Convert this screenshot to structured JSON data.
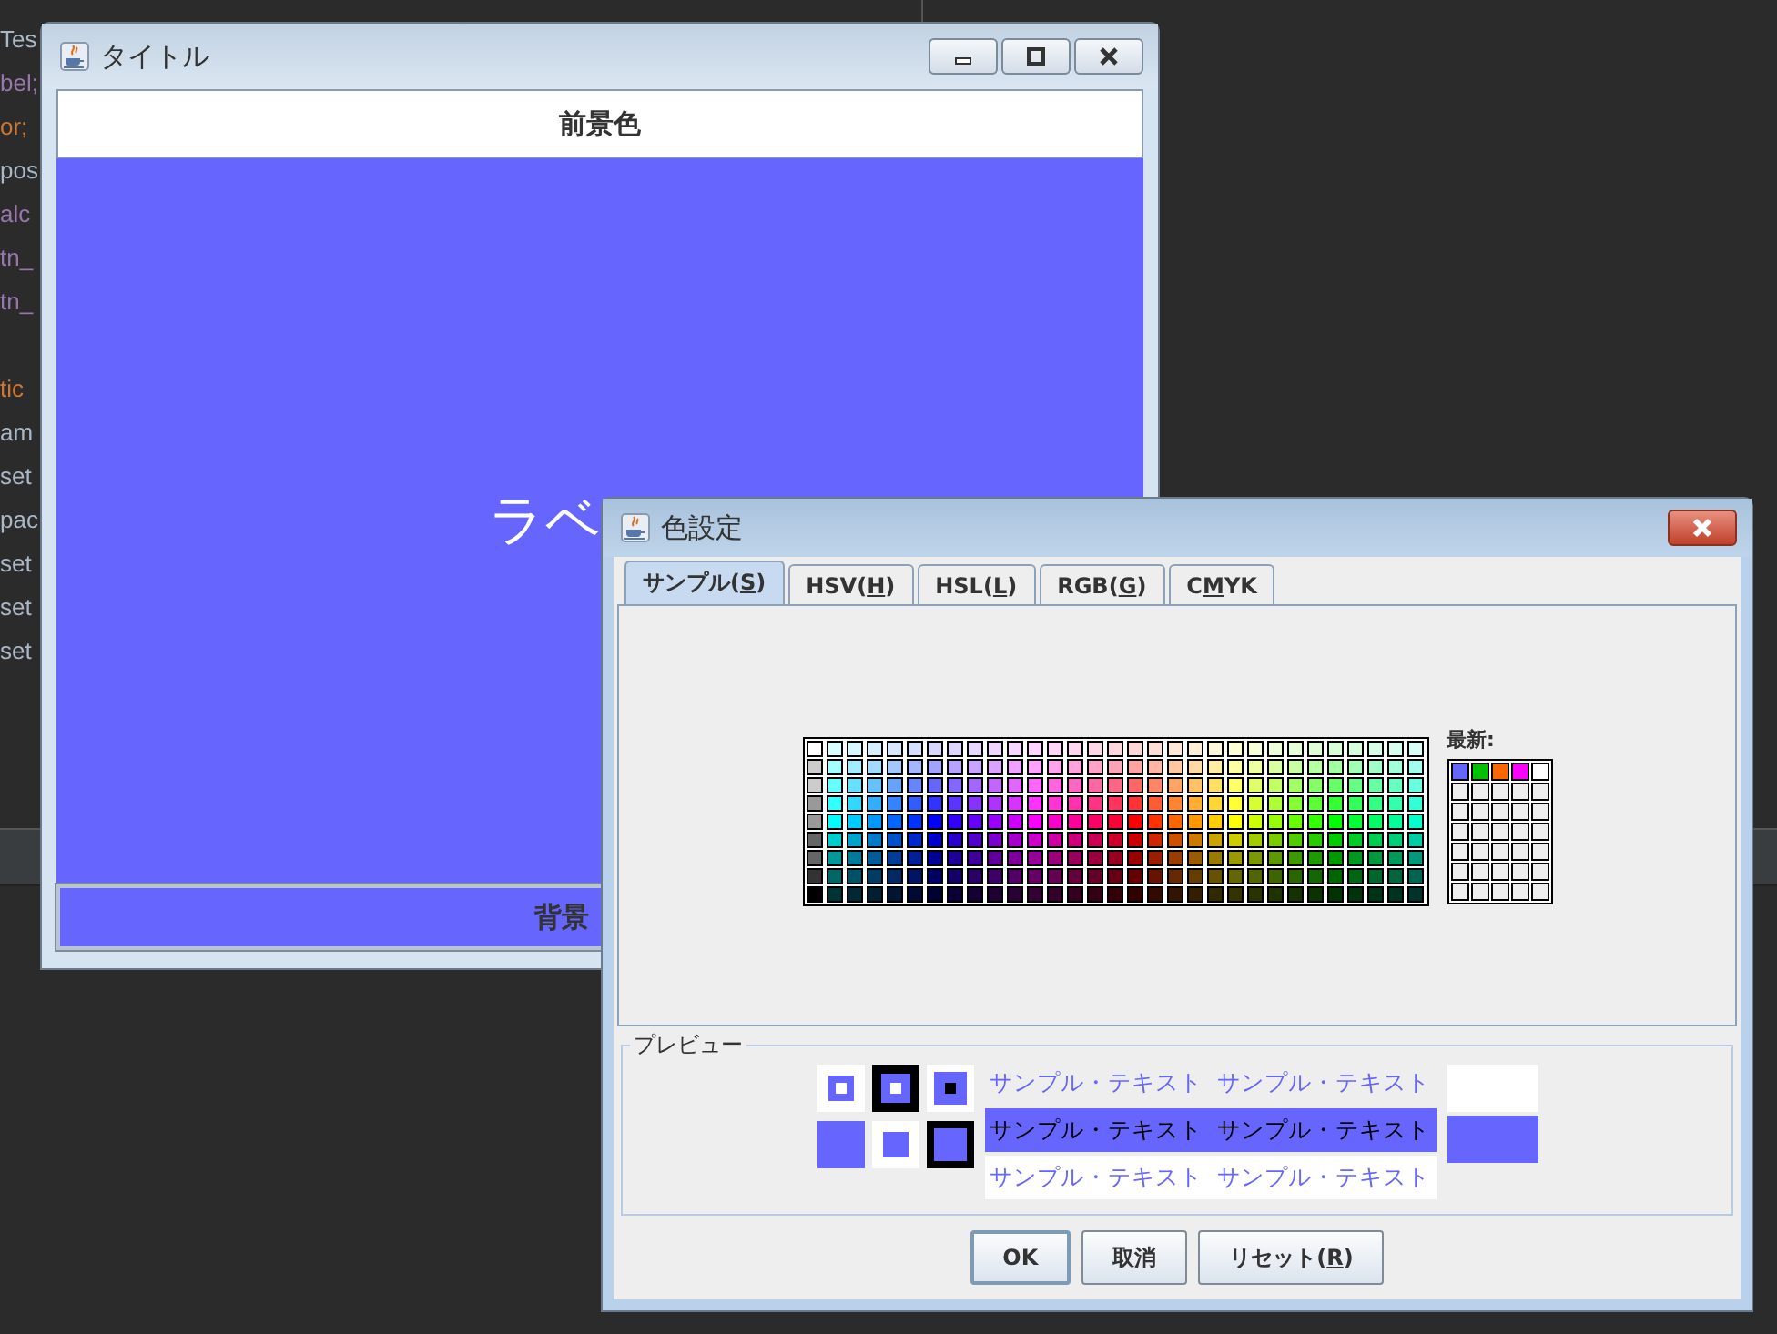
{
  "editor_lines": [
    {
      "kind": "text",
      "text": "Tes",
      "color": "#a9b7c6"
    },
    {
      "kind": "text",
      "text": "bel;",
      "color": "#9876aa"
    },
    {
      "kind": "text",
      "text": "or;",
      "color": "#cc7832"
    },
    {
      "kind": "text",
      "text": "pos",
      "color": "#a9b7c6"
    },
    {
      "kind": "text",
      "text": "alc",
      "color": "#9876aa"
    },
    {
      "kind": "text",
      "text": "tn_",
      "color": "#9876aa"
    },
    {
      "kind": "text",
      "text": "tn_",
      "color": "#9876aa"
    },
    {
      "kind": "blank"
    },
    {
      "kind": "text",
      "text": "tic",
      "color": "#cc7832"
    },
    {
      "kind": "text",
      "text": "am",
      "color": "#a9b7c6"
    },
    {
      "kind": "text",
      "text": "set",
      "color": "#a9b7c6"
    },
    {
      "kind": "text",
      "text": "pac",
      "color": "#a9b7c6"
    },
    {
      "kind": "text",
      "text": "set",
      "color": "#a9b7c6"
    },
    {
      "kind": "text",
      "text": "set",
      "color": "#a9b7c6"
    },
    {
      "kind": "text",
      "text": "set",
      "color": "#a9b7c6"
    }
  ],
  "main_window": {
    "title": "タイトル",
    "header": "前景色",
    "label": "ラベ",
    "color": "#6666ff",
    "bottom_button": "背景"
  },
  "color_dialog": {
    "title": "色設定",
    "tabs": [
      {
        "before": "サンプル(",
        "key": "S",
        "after": ")",
        "selected": true
      },
      {
        "before": "HSV(",
        "key": "H",
        "after": ")",
        "selected": false
      },
      {
        "before": "HSL(",
        "key": "L",
        "after": ")",
        "selected": false
      },
      {
        "before": "RGB(",
        "key": "G",
        "after": ")",
        "selected": false
      },
      {
        "before": "C",
        "key": "M",
        "after": "YK",
        "selected": false
      }
    ],
    "recent_label": "最新:",
    "recent": [
      {
        "color": "#6666ff"
      },
      {
        "color": "#00c000"
      },
      {
        "color": "#ff6600"
      },
      {
        "color": "#ff00ff"
      },
      {
        "color": "#ffffff"
      }
    ],
    "preview": {
      "legend": "プレビュー",
      "color": "#6666ff",
      "rows": [
        {
          "kind": "plain",
          "texts": [
            "サンプル・テキスト",
            "サンプル・テキスト"
          ]
        },
        {
          "kind": "highlight",
          "texts": [
            "サンプル・テキスト",
            "サンプル・テキスト"
          ]
        },
        {
          "kind": "white",
          "texts": [
            "サンプル・テキスト",
            "サンプル・テキスト"
          ]
        }
      ]
    },
    "buttons": [
      {
        "before": "OK",
        "focused": true
      },
      {
        "before": "取消",
        "focused": false
      },
      {
        "before": "リセット(",
        "key": "R",
        "after": ")",
        "focused": false
      }
    ]
  }
}
